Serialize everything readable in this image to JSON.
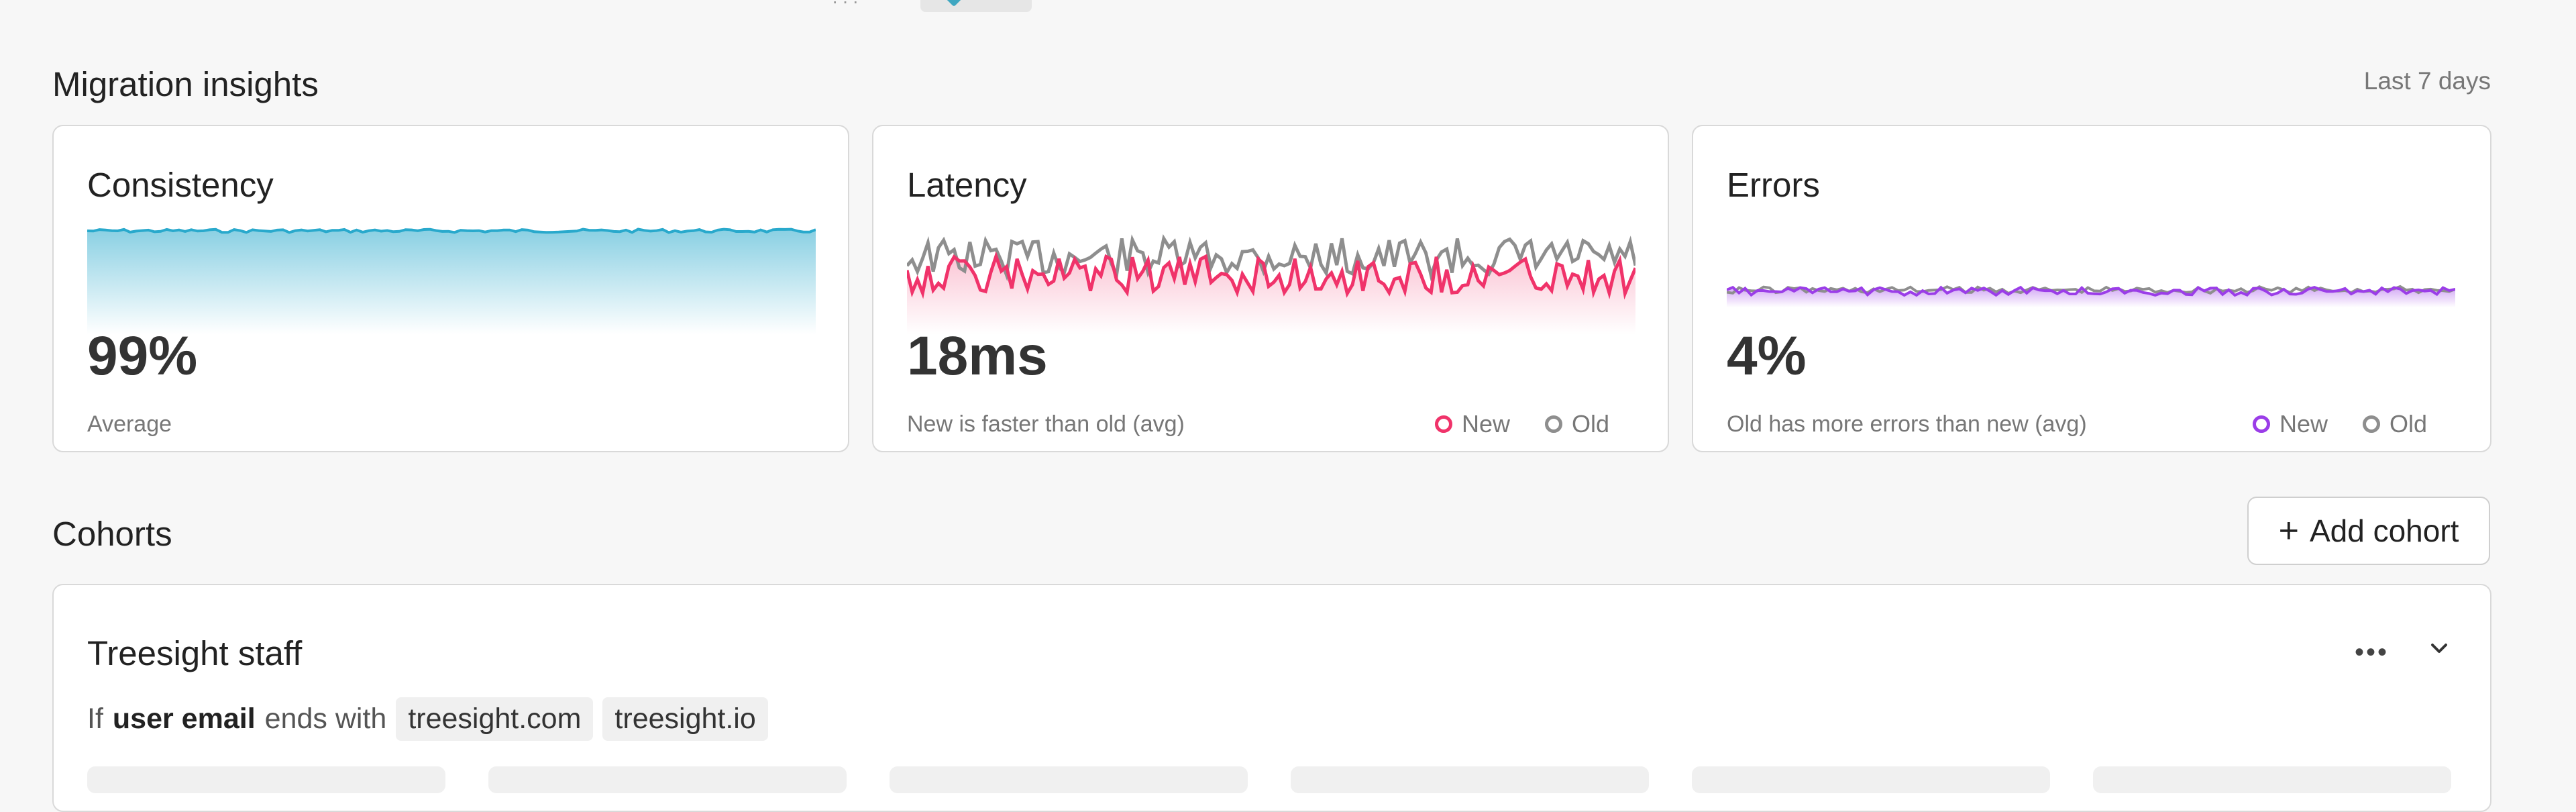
{
  "insights": {
    "title": "Migration insights",
    "range": "Last 7 days",
    "cards": [
      {
        "title": "Consistency",
        "value": "99%",
        "subtitle": "Average",
        "color": "#29a9cc"
      },
      {
        "title": "Latency",
        "value": "18ms",
        "subtitle": "New is faster than old (avg)",
        "new_label": "New",
        "old_label": "Old",
        "new_color": "#f0336a",
        "old_color": "#8e8e8e"
      },
      {
        "title": "Errors",
        "value": "4%",
        "subtitle": "Old has more errors than new (avg)",
        "new_label": "New",
        "old_label": "Old",
        "new_color": "#9b3de8",
        "old_color": "#8e8e8e"
      }
    ]
  },
  "cohorts": {
    "title": "Cohorts",
    "add_label": "Add cohort",
    "items": [
      {
        "name": "Treesight staff",
        "rule_prefix": "If",
        "rule_field": "user email",
        "rule_op": "ends with",
        "tags": [
          "treesight.com",
          "treesight.io"
        ]
      }
    ]
  }
}
